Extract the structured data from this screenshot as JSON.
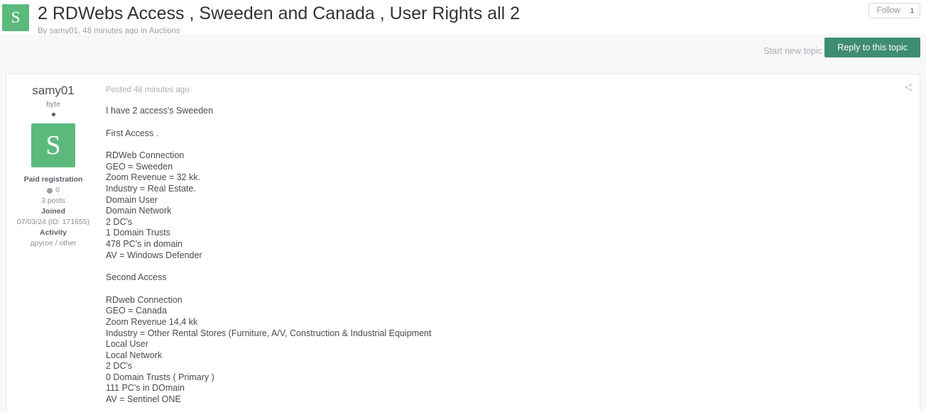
{
  "header": {
    "logo_letter": "S",
    "title": "2 RDWebs Access , Sweeden and Canada , User Rights all 2",
    "byline_prefix": "By",
    "byline_author": "samy01",
    "byline_middle": ", 48 minutes ago in",
    "byline_forum": "Auctions",
    "follow_label": "Follow",
    "follow_count": "1"
  },
  "actions": {
    "start_new_topic": "Start new topic",
    "reply_to_topic": "Reply to this topic"
  },
  "post": {
    "date": "Posted 48 minutes ago",
    "intro": "I have 2 access's Sweeden",
    "first_heading": "First Access .",
    "first_access": [
      "RDWeb Connection",
      "GEO = Sweeden",
      "Zoom Revenue = 32 kk.",
      "Industry = Real Estate.",
      "Domain User",
      "Domain Network",
      "2 DC's",
      "1 Domain Trusts",
      "478 PC's in domain",
      "AV = Windows Defender"
    ],
    "second_heading": "Second Access",
    "second_access": [
      "RDweb Connection",
      "GEO = Canada",
      "Zoom Revenue 14,4 kk",
      "Industry = Other Rental Stores (Furniture, A/V, Construction & Industrial Equipment",
      "Local User",
      "Local Network",
      "2 DC's",
      "0 Domain Trusts ( Primary )",
      "111 PC's in DOmain",
      "AV = Sentinel ONE"
    ]
  },
  "author": {
    "name": "samy01",
    "rank": "byte",
    "avatar_letter": "S",
    "registration": "Paid registration",
    "reputation": "0",
    "posts": "3 posts",
    "joined_label": "Joined",
    "joined_value": "07/03/24 (ID: 171655)",
    "activity_label": "Activity",
    "activity_value": "другое / other"
  },
  "colors": {
    "brand_green": "#5cb97c",
    "button_green": "#3f8d70",
    "page_bg": "#f7f8f8",
    "panel_bg": "#ffffff"
  }
}
